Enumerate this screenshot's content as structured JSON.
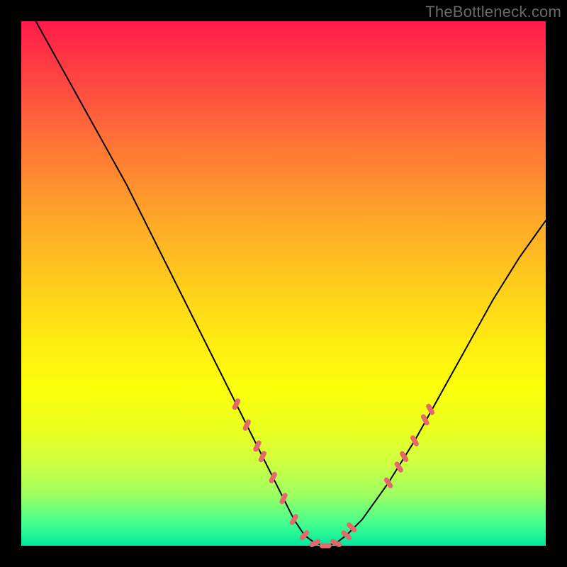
{
  "watermark": "TheBottleneck.com",
  "colors": {
    "curve": "#000000",
    "marker": "#e46a6a",
    "background_top": "#ff1a4d",
    "background_bottom": "#00e8a0",
    "frame": "#000000"
  },
  "chart_data": {
    "type": "line",
    "title": "",
    "xlabel": "",
    "ylabel": "",
    "xlim": [
      0,
      100
    ],
    "ylim": [
      0,
      100
    ],
    "grid": false,
    "series": [
      {
        "name": "bottleneck-curve",
        "x": [
          0,
          5,
          10,
          15,
          20,
          25,
          30,
          35,
          40,
          45,
          50,
          52,
          54,
          56,
          58,
          60,
          62,
          65,
          70,
          75,
          80,
          85,
          90,
          95,
          100
        ],
        "values": [
          105,
          96,
          87,
          78,
          69,
          59,
          49,
          39,
          29,
          19,
          9,
          5,
          2,
          0.5,
          0,
          0.5,
          2,
          5,
          12,
          20,
          29,
          38,
          47,
          55,
          62
        ]
      }
    ],
    "markers": {
      "name": "highlighted-points",
      "x": [
        41,
        43,
        45,
        46,
        48,
        50,
        52,
        54,
        56,
        58,
        60,
        62,
        63,
        70,
        72,
        73,
        75,
        77,
        78
      ],
      "values": [
        27,
        23,
        19,
        17,
        13,
        9,
        5,
        2,
        0.5,
        0,
        0.5,
        2,
        3.5,
        12,
        15,
        17,
        20,
        24,
        26
      ]
    }
  }
}
